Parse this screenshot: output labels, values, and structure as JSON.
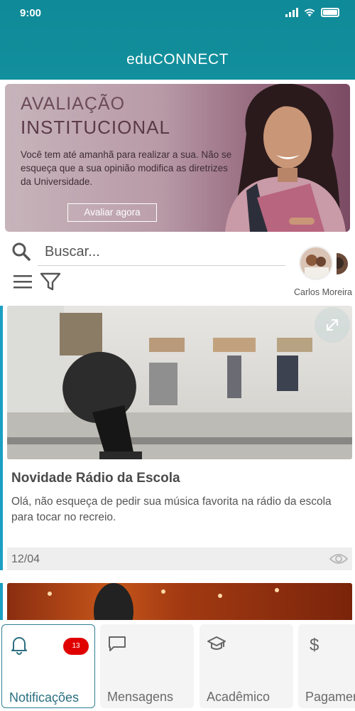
{
  "status_bar": {
    "time": "9:00"
  },
  "app": {
    "title": "eduCONNECT"
  },
  "banner": {
    "kicker": "AVALIAÇÃO",
    "title": "INSTITUCIONAL",
    "text": "Você tem até amanhã para realizar a sua. Não se esqueça que a sua opinião modifica as diretrizes da Universidade.",
    "button_label": "Avaliar agora"
  },
  "search": {
    "placeholder": "Buscar..."
  },
  "contacts": {
    "first_name": "Carlos Moreira"
  },
  "feed": {
    "items": [
      {
        "title": "Novidade Rádio da Escola",
        "body": "Olá, não esqueça de pedir sua música favorita na rádio da escola para tocar no recreio.",
        "date": "12/04"
      }
    ]
  },
  "bottom_nav": {
    "items": [
      {
        "label": "Notificações",
        "icon": "bell-icon",
        "badge": "13",
        "active": true
      },
      {
        "label": "Mensagens",
        "icon": "chat-icon"
      },
      {
        "label": "Acadêmico",
        "icon": "graduation-cap-icon"
      },
      {
        "label": "Pagamentos",
        "icon": "dollar-icon"
      }
    ]
  },
  "colors": {
    "primary": "#128f9c",
    "accent": "#1b9fc3",
    "badge": "#e00000"
  }
}
